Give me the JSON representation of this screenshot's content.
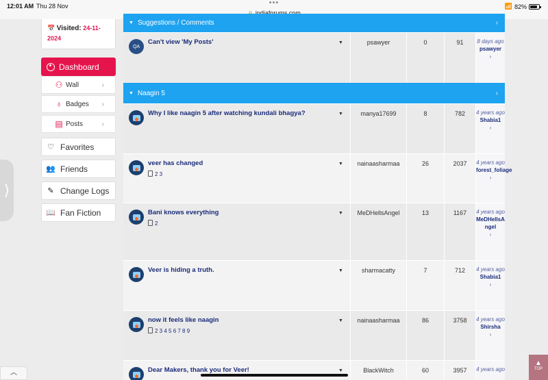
{
  "status_bar": {
    "time": "12:01 AM",
    "date": "Thu 28 Nov",
    "url": "indiaforums.com",
    "battery_text": "82%",
    "battery_level": 0.82
  },
  "sidebar": {
    "visited_label": "Visited:",
    "visited_value": "24-11-2024",
    "dashboard_label": "Dashboard",
    "sub_items": [
      {
        "label": "Wall",
        "icon": "user-outline-icon"
      },
      {
        "label": "Badges",
        "icon": "badge-icon"
      },
      {
        "label": "Posts",
        "icon": "document-icon"
      }
    ],
    "buttons": [
      {
        "label": "Favorites",
        "icon": "heart-icon"
      },
      {
        "label": "Friends",
        "icon": "users-icon"
      },
      {
        "label": "Change Logs",
        "icon": "edit-icon"
      },
      {
        "label": "Fan Fiction",
        "icon": "book-icon"
      }
    ]
  },
  "sections": [
    {
      "name": "Suggestions / Comments",
      "topics": [
        {
          "title": "Can't view 'My Posts'",
          "pages": "",
          "author": "psawyer",
          "replies": "0",
          "views": "91",
          "last_ago": "8 days ago",
          "last_by": "psawyer",
          "avatar": "QA"
        }
      ]
    },
    {
      "name": "Naagin 5",
      "topics": [
        {
          "title": "Why I like naagin 5 after watching kundali bhagya?",
          "pages": "",
          "author": "manya17699",
          "replies": "8",
          "views": "782",
          "last_ago": "4 years ago",
          "last_by": "Shabia1"
        },
        {
          "title": "veer has changed",
          "pages": "2 3",
          "author": "nainaasharmaa",
          "replies": "26",
          "views": "2037",
          "last_ago": "4 years ago",
          "last_by": "forest_foliage"
        },
        {
          "title": "Bani knows everything",
          "pages": "2",
          "author": "MeDHellsAngel",
          "replies": "13",
          "views": "1167",
          "last_ago": "4 years ago",
          "last_by": "MeDHellsAngel"
        },
        {
          "title": "Veer is hiding a truth.",
          "pages": "",
          "author": "sharmacatty",
          "replies": "7",
          "views": "712",
          "last_ago": "4 years ago",
          "last_by": "Shabia1"
        },
        {
          "title": "now it feels like naagin",
          "pages": "2 3 4 5 6 7 8 9",
          "author": "nainaasharmaa",
          "replies": "86",
          "views": "3758",
          "last_ago": "4 years ago",
          "last_by": "Shirsha"
        },
        {
          "title": "Dear Makers, thank you for Veer!",
          "pages": "",
          "author": "BlackWitch",
          "replies": "60",
          "views": "3957",
          "last_ago": "4 years ago",
          "last_by": ""
        }
      ]
    }
  ],
  "more_glyph": "›",
  "top_button_label": "TOP"
}
